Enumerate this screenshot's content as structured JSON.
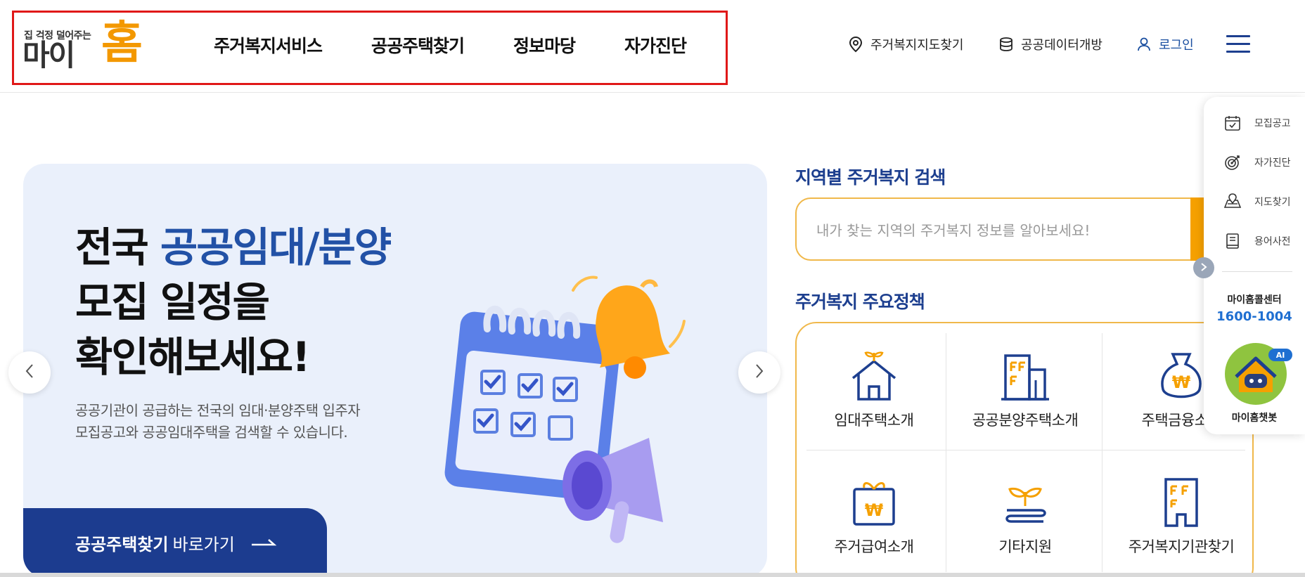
{
  "logo": {
    "tagline": "집 걱정 덜어주는",
    "main": "마이",
    "home": "홈"
  },
  "gnb": [
    "주거복지서비스",
    "공공주택찾기",
    "정보마당",
    "자가진단"
  ],
  "util": {
    "map": "주거복지지도찾기",
    "data": "공공데이터개방",
    "login": "로그인"
  },
  "hero": {
    "title_line1_plain": "전국 ",
    "title_line1_accent": "공공임대/분양",
    "title_line2": "모집 일정을",
    "title_line3": "확인해보세요!",
    "desc": "공공기관이 공급하는 전국의 임대·분양주택 입주자 모집공고와 공공임대주택을 검색할 수 있습니다.",
    "cta_bold": "공공주택찾기",
    "cta_rest": "바로가기"
  },
  "region_search": {
    "title": "지역별 주거복지 검색",
    "placeholder": "내가 찾는 지역의 주거복지 정보를 알아보세요!"
  },
  "policy": {
    "title": "주거복지 주요정책",
    "items": [
      "임대주택소개",
      "공공분양주택소개",
      "주택금융소개",
      "주거급여소개",
      "기타지원",
      "주거복지기관찾기"
    ]
  },
  "quick": {
    "items": [
      "모집공고",
      "자가진단",
      "지도찾기",
      "용어사전"
    ],
    "call_label": "마이홈콜센터",
    "call_number": "1600-1004",
    "chatbot_badge": "AI",
    "chatbot_label": "마이홈챗봇"
  },
  "colors": {
    "brand_navy": "#1d3f8f",
    "brand_orange": "#f39800",
    "hero_bg": "#eaf0fb"
  }
}
